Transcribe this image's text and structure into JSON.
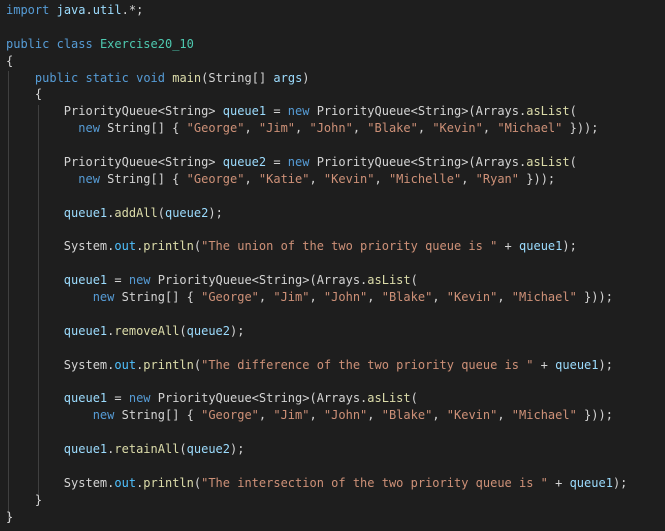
{
  "editor": {
    "colors": {
      "background": "#1e1e1e",
      "keyword": "#569cd6",
      "type": "#4ec9b0",
      "function": "#dcdcaa",
      "variable": "#9cdcfe",
      "string": "#ce9178",
      "field": "#4fc1ff",
      "plain": "#d4d4d4"
    },
    "lines": [
      [
        [
          "kw",
          "import"
        ],
        [
          "p",
          " "
        ],
        [
          "var",
          "java"
        ],
        [
          "p",
          "."
        ],
        [
          "var",
          "util"
        ],
        [
          "p",
          ".*;"
        ]
      ],
      [],
      [
        [
          "kw",
          "public"
        ],
        [
          "p",
          " "
        ],
        [
          "kw",
          "class"
        ],
        [
          "p",
          " "
        ],
        [
          "type",
          "Exercise20_10"
        ]
      ],
      [
        [
          "p",
          "{"
        ]
      ],
      [
        [
          "p",
          "    "
        ],
        [
          "kw",
          "public"
        ],
        [
          "p",
          " "
        ],
        [
          "kw",
          "static"
        ],
        [
          "p",
          " "
        ],
        [
          "kw",
          "void"
        ],
        [
          "p",
          " "
        ],
        [
          "fn",
          "main"
        ],
        [
          "p",
          "(String[] "
        ],
        [
          "var",
          "args"
        ],
        [
          "p",
          ")"
        ]
      ],
      [
        [
          "p",
          "    {"
        ]
      ],
      [
        [
          "p",
          "        PriorityQueue<String> "
        ],
        [
          "var",
          "queue1"
        ],
        [
          "p",
          " = "
        ],
        [
          "kw",
          "new"
        ],
        [
          "p",
          " PriorityQueue<String>(Arrays."
        ],
        [
          "fn",
          "asList"
        ],
        [
          "p",
          "("
        ]
      ],
      [
        [
          "p",
          "          "
        ],
        [
          "kw",
          "new"
        ],
        [
          "p",
          " String[] { "
        ],
        [
          "str",
          "\"George\""
        ],
        [
          "p",
          ", "
        ],
        [
          "str",
          "\"Jim\""
        ],
        [
          "p",
          ", "
        ],
        [
          "str",
          "\"John\""
        ],
        [
          "p",
          ", "
        ],
        [
          "str",
          "\"Blake\""
        ],
        [
          "p",
          ", "
        ],
        [
          "str",
          "\"Kevin\""
        ],
        [
          "p",
          ", "
        ],
        [
          "str",
          "\"Michael\""
        ],
        [
          "p",
          " }));"
        ]
      ],
      [],
      [
        [
          "p",
          "        PriorityQueue<String> "
        ],
        [
          "var",
          "queue2"
        ],
        [
          "p",
          " = "
        ],
        [
          "kw",
          "new"
        ],
        [
          "p",
          " PriorityQueue<String>(Arrays."
        ],
        [
          "fn",
          "asList"
        ],
        [
          "p",
          "("
        ]
      ],
      [
        [
          "p",
          "          "
        ],
        [
          "kw",
          "new"
        ],
        [
          "p",
          " String[] { "
        ],
        [
          "str",
          "\"George\""
        ],
        [
          "p",
          ", "
        ],
        [
          "str",
          "\"Katie\""
        ],
        [
          "p",
          ", "
        ],
        [
          "str",
          "\"Kevin\""
        ],
        [
          "p",
          ", "
        ],
        [
          "str",
          "\"Michelle\""
        ],
        [
          "p",
          ", "
        ],
        [
          "str",
          "\"Ryan\""
        ],
        [
          "p",
          " }));"
        ]
      ],
      [],
      [
        [
          "p",
          "        "
        ],
        [
          "var",
          "queue1"
        ],
        [
          "p",
          "."
        ],
        [
          "fn",
          "addAll"
        ],
        [
          "p",
          "("
        ],
        [
          "var",
          "queue2"
        ],
        [
          "p",
          ");"
        ]
      ],
      [],
      [
        [
          "p",
          "        System."
        ],
        [
          "field",
          "out"
        ],
        [
          "p",
          "."
        ],
        [
          "fn",
          "println"
        ],
        [
          "p",
          "("
        ],
        [
          "str",
          "\"The union of the two priority queue is \""
        ],
        [
          "p",
          " + "
        ],
        [
          "var",
          "queue1"
        ],
        [
          "p",
          ");"
        ]
      ],
      [],
      [
        [
          "p",
          "        "
        ],
        [
          "var",
          "queue1"
        ],
        [
          "p",
          " = "
        ],
        [
          "kw",
          "new"
        ],
        [
          "p",
          " PriorityQueue<String>(Arrays."
        ],
        [
          "fn",
          "asList"
        ],
        [
          "p",
          "("
        ]
      ],
      [
        [
          "p",
          "            "
        ],
        [
          "kw",
          "new"
        ],
        [
          "p",
          " String[] { "
        ],
        [
          "str",
          "\"George\""
        ],
        [
          "p",
          ", "
        ],
        [
          "str",
          "\"Jim\""
        ],
        [
          "p",
          ", "
        ],
        [
          "str",
          "\"John\""
        ],
        [
          "p",
          ", "
        ],
        [
          "str",
          "\"Blake\""
        ],
        [
          "p",
          ", "
        ],
        [
          "str",
          "\"Kevin\""
        ],
        [
          "p",
          ", "
        ],
        [
          "str",
          "\"Michael\""
        ],
        [
          "p",
          " }));"
        ]
      ],
      [],
      [
        [
          "p",
          "        "
        ],
        [
          "var",
          "queue1"
        ],
        [
          "p",
          "."
        ],
        [
          "fn",
          "removeAll"
        ],
        [
          "p",
          "("
        ],
        [
          "var",
          "queue2"
        ],
        [
          "p",
          ");"
        ]
      ],
      [],
      [
        [
          "p",
          "        System."
        ],
        [
          "field",
          "out"
        ],
        [
          "p",
          "."
        ],
        [
          "fn",
          "println"
        ],
        [
          "p",
          "("
        ],
        [
          "str",
          "\"The difference of the two priority queue is \""
        ],
        [
          "p",
          " + "
        ],
        [
          "var",
          "queue1"
        ],
        [
          "p",
          ");"
        ]
      ],
      [],
      [
        [
          "p",
          "        "
        ],
        [
          "var",
          "queue1"
        ],
        [
          "p",
          " = "
        ],
        [
          "kw",
          "new"
        ],
        [
          "p",
          " PriorityQueue<String>(Arrays."
        ],
        [
          "fn",
          "asList"
        ],
        [
          "p",
          "("
        ]
      ],
      [
        [
          "p",
          "            "
        ],
        [
          "kw",
          "new"
        ],
        [
          "p",
          " String[] { "
        ],
        [
          "str",
          "\"George\""
        ],
        [
          "p",
          ", "
        ],
        [
          "str",
          "\"Jim\""
        ],
        [
          "p",
          ", "
        ],
        [
          "str",
          "\"John\""
        ],
        [
          "p",
          ", "
        ],
        [
          "str",
          "\"Blake\""
        ],
        [
          "p",
          ", "
        ],
        [
          "str",
          "\"Kevin\""
        ],
        [
          "p",
          ", "
        ],
        [
          "str",
          "\"Michael\""
        ],
        [
          "p",
          " }));"
        ]
      ],
      [],
      [
        [
          "p",
          "        "
        ],
        [
          "var",
          "queue1"
        ],
        [
          "p",
          "."
        ],
        [
          "fn",
          "retainAll"
        ],
        [
          "p",
          "("
        ],
        [
          "var",
          "queue2"
        ],
        [
          "p",
          ");"
        ]
      ],
      [],
      [
        [
          "p",
          "        System."
        ],
        [
          "field",
          "out"
        ],
        [
          "p",
          "."
        ],
        [
          "fn",
          "println"
        ],
        [
          "p",
          "("
        ],
        [
          "str",
          "\"The intersection of the two priority queue is \""
        ],
        [
          "p",
          " + "
        ],
        [
          "var",
          "queue1"
        ],
        [
          "p",
          ");"
        ]
      ],
      [
        [
          "p",
          "    }"
        ]
      ],
      [
        [
          "p",
          "}"
        ]
      ]
    ]
  }
}
